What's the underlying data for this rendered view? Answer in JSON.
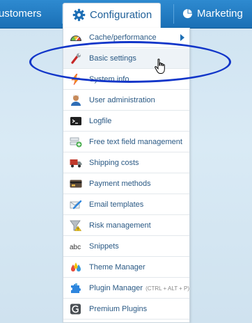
{
  "nav": {
    "customers_label": "ustomers",
    "configuration_label": "Configuration",
    "marketing_label": "Marketing"
  },
  "menu": {
    "items": [
      {
        "label": "Cache/performance",
        "icon": "speedometer-icon",
        "has_submenu": true
      },
      {
        "label": "Basic settings",
        "icon": "wrench-icon",
        "hovered": true
      },
      {
        "label": "System info",
        "icon": "lightning-icon"
      },
      {
        "label": "User administration",
        "icon": "user-icon"
      },
      {
        "label": "Logfile",
        "icon": "terminal-icon"
      },
      {
        "label": "Free text field management",
        "icon": "field-add-icon"
      },
      {
        "label": "Shipping costs",
        "icon": "truck-icon"
      },
      {
        "label": "Payment methods",
        "icon": "credit-card-icon"
      },
      {
        "label": "Email templates",
        "icon": "email-edit-icon"
      },
      {
        "label": "Risk management",
        "icon": "funnel-warning-icon"
      },
      {
        "label": "Snippets",
        "icon": "text-abc-icon"
      },
      {
        "label": "Theme Manager",
        "icon": "color-drops-icon"
      },
      {
        "label": "Plugin Manager",
        "shortcut": "(CTRL + ALT + P)",
        "icon": "puzzle-icon"
      },
      {
        "label": "Premium Plugins",
        "icon": "premium-plugins-icon"
      }
    ]
  },
  "colors": {
    "nav_blue": "#1a6fb5",
    "link_text": "#2a5984",
    "annotation": "#1236c9"
  }
}
